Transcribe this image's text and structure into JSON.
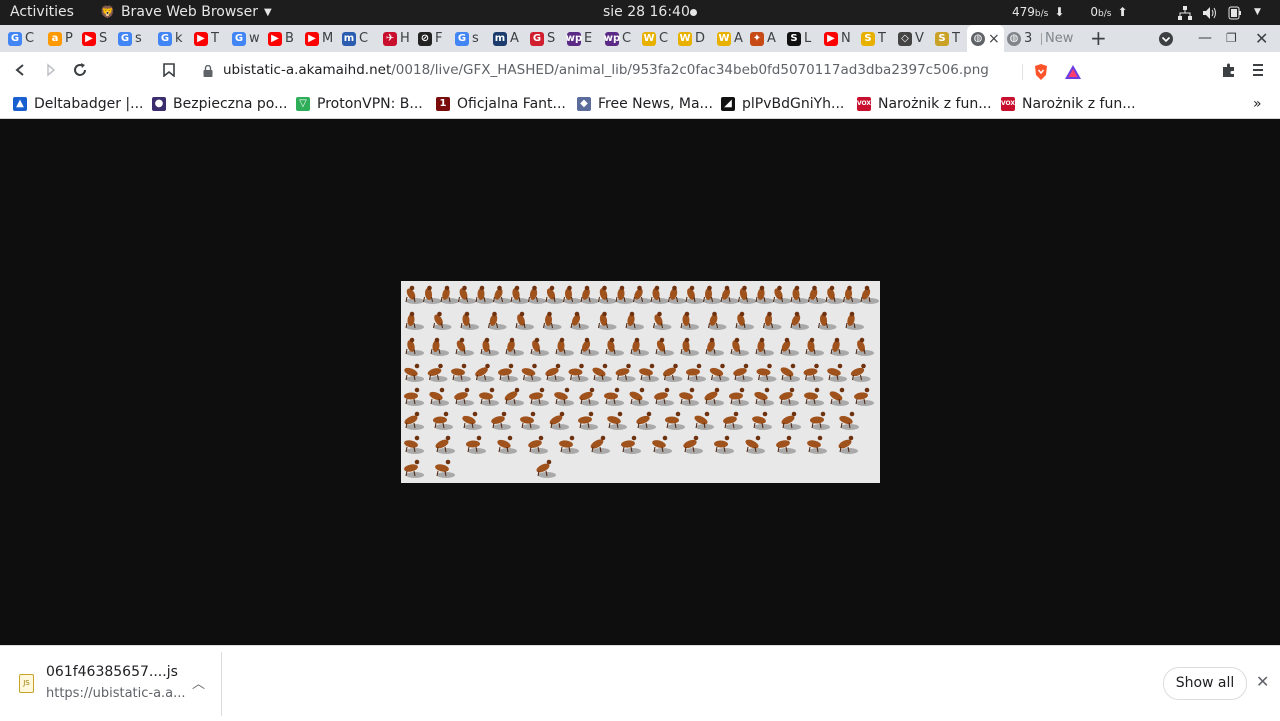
{
  "topbar": {
    "activities": "Activities",
    "app_name": "Brave Web Browser",
    "clock": "sie 28  16:40",
    "download_speed": "479",
    "download_unit": "b/s",
    "upload_speed": "0",
    "upload_unit": "b/s"
  },
  "tabs": [
    {
      "letter": "C",
      "fav": "G",
      "color": "#4285f4"
    },
    {
      "letter": "P",
      "fav": "a",
      "color": "#ff9900"
    },
    {
      "letter": "S",
      "fav": "▶",
      "color": "#ff0000"
    },
    {
      "letter": "s",
      "fav": "G",
      "color": "#4285f4"
    },
    {
      "letter": "k",
      "fav": "G",
      "color": "#4285f4"
    },
    {
      "letter": "T",
      "fav": "▶",
      "color": "#ff0000"
    },
    {
      "letter": "w",
      "fav": "G",
      "color": "#4285f4"
    },
    {
      "letter": "B",
      "fav": "▶",
      "color": "#ff0000"
    },
    {
      "letter": "M",
      "fav": "▶",
      "color": "#ff0000"
    },
    {
      "letter": "C",
      "fav": "m",
      "color": "#2a5db0"
    },
    {
      "letter": "H",
      "fav": "✈",
      "color": "#c8102e"
    },
    {
      "letter": "F",
      "fav": "⊘",
      "color": "#222222"
    },
    {
      "letter": "s",
      "fav": "G",
      "color": "#4285f4"
    },
    {
      "letter": "A",
      "fav": "m",
      "color": "#1d3c6e"
    },
    {
      "letter": "S",
      "fav": "G",
      "color": "#d01f2f"
    },
    {
      "letter": "E",
      "fav": "wp",
      "color": "#5b2a86"
    },
    {
      "letter": "C",
      "fav": "wp",
      "color": "#5b2a86"
    },
    {
      "letter": "C",
      "fav": "W",
      "color": "#e8b100"
    },
    {
      "letter": "D",
      "fav": "W",
      "color": "#e8b100"
    },
    {
      "letter": "A",
      "fav": "W",
      "color": "#e8b100"
    },
    {
      "letter": "A",
      "fav": "✦",
      "color": "#c74b16"
    },
    {
      "letter": "L",
      "fav": "S",
      "color": "#111111"
    },
    {
      "letter": "N",
      "fav": "▶",
      "color": "#ff0000"
    },
    {
      "letter": "T",
      "fav": "S",
      "color": "#e8b100"
    },
    {
      "letter": "V",
      "fav": "◇",
      "color": "#444444"
    },
    {
      "letter": "T",
      "fav": "S",
      "color": "#c9a227"
    }
  ],
  "active_tab": {
    "close": "×"
  },
  "tab_3": {
    "label": "3"
  },
  "new_tab": {
    "label": "New"
  },
  "address": {
    "host": "ubistatic-a.akamaihd.net",
    "path": "/0018/live/GFX_HASHED/animal_lib/953fa2c0fac34beb0fd5070117ad3dba2397c506.png"
  },
  "bookmarks": [
    {
      "label": "Deltabadger |...",
      "icon": "▲",
      "color": "#1a5fd0"
    },
    {
      "label": "Bezpieczna po...",
      "icon": "●",
      "color": "#3b2d6e"
    },
    {
      "label": "ProtonVPN: B...",
      "icon": "▽",
      "color": "#2fae5a"
    },
    {
      "label": "Oficjalna Fant...",
      "icon": "1",
      "color": "#7a0c0c"
    },
    {
      "label": "Free News, Ma...",
      "icon": "◆",
      "color": "#5a6b9c"
    },
    {
      "label": "plPvBdGniYh...",
      "icon": "◢",
      "color": "#111111"
    },
    {
      "label": "Narożnik z fun...",
      "icon": "VOX",
      "color": "#c8102e"
    },
    {
      "label": "Narożnik z fun...",
      "icon": "VOX",
      "color": "#c8102e"
    }
  ],
  "download": {
    "icon_label": "JS",
    "filename": "061f46385657....js",
    "url": "https://ubistatic-a.a...",
    "show_all": "Show all"
  }
}
